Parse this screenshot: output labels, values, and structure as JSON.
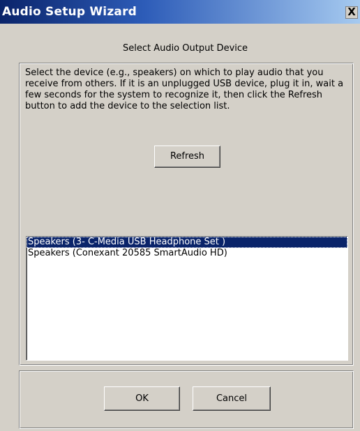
{
  "window": {
    "title": "Audio Setup Wizard",
    "close_glyph": "X"
  },
  "header": {
    "subtitle": "Select Audio Output Device"
  },
  "main": {
    "description": "Select the device (e.g., speakers) on which to play audio that you receive from others. If it is an unplugged USB device, plug it in, wait a few seconds for the system to recognize it, then click the Refresh button to add the device to the selection list.",
    "refresh_label": "Refresh",
    "devices": [
      {
        "label": "Speakers (3- C-Media USB Headphone Set  )",
        "selected": true
      },
      {
        "label": "Speakers (Conexant 20585 SmartAudio HD)",
        "selected": false
      }
    ]
  },
  "footer": {
    "ok_label": "OK",
    "cancel_label": "Cancel"
  },
  "colors": {
    "selection": "#0a246a",
    "face": "#d4d0c8",
    "titlebar_start": "#0a246a",
    "titlebar_end": "#a6caf0"
  }
}
